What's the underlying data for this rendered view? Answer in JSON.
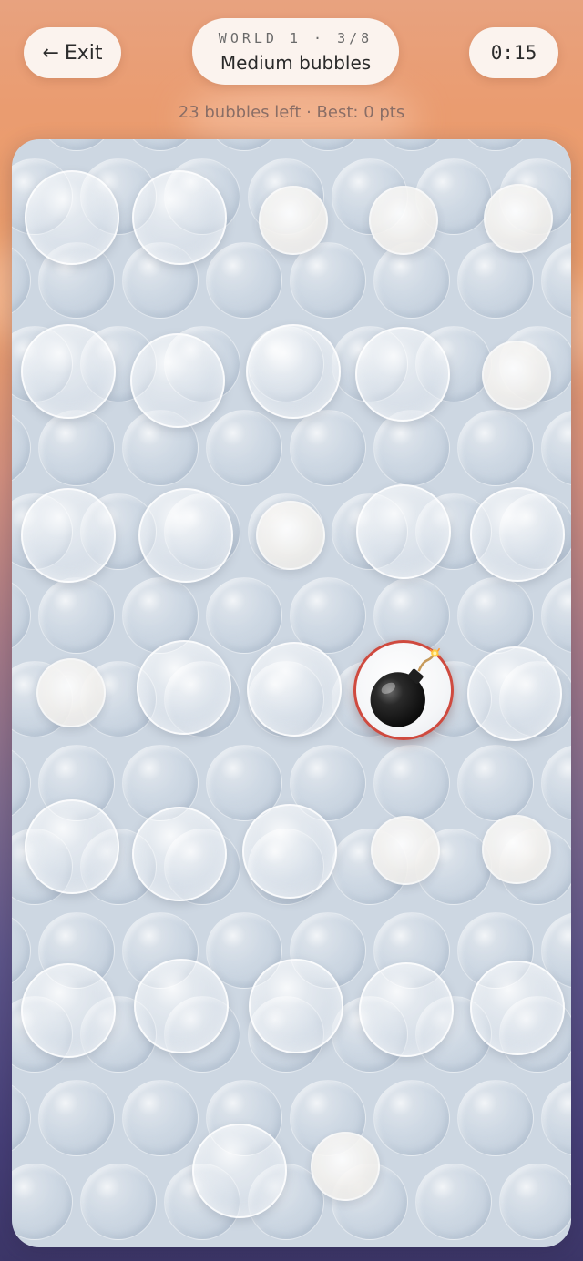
{
  "header": {
    "exit_label": "Exit",
    "exit_arrow": "←",
    "world_label": "WORLD 1 · 3/8",
    "level_title": "Medium bubbles",
    "timer": "0:15"
  },
  "status": {
    "text": "23 bubbles left · Best: 0 pts"
  },
  "board": {
    "accent_bomb_ring": "#cf4a3f",
    "background": "#cdd7e2"
  },
  "icons": {
    "exit": "arrow-left-icon",
    "bomb": "bomb-icon"
  }
}
